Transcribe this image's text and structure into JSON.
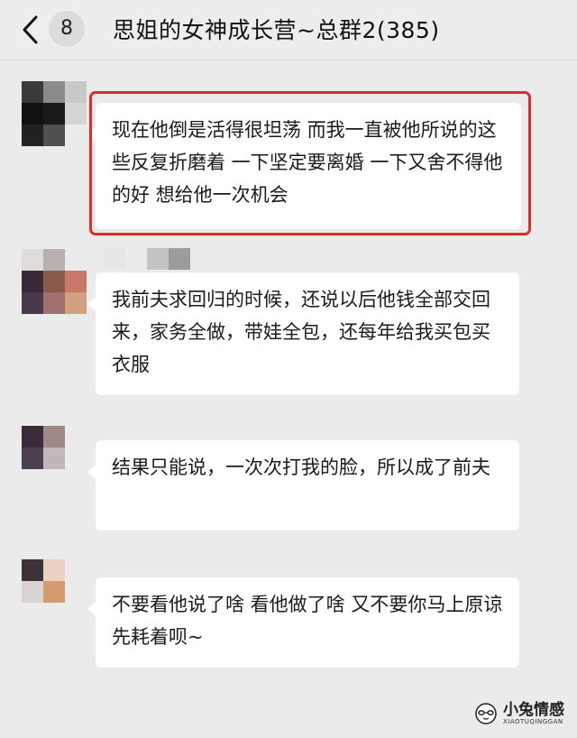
{
  "header": {
    "unread_count": "8",
    "title": "思姐的女神成长营~总群2(385)"
  },
  "messages": [
    {
      "text": "现在他倒是活得很坦荡 而我一直被他所说的这些反复折磨着 一下坚定要离婚 一下又舍不得他的好 想给他一次机会",
      "highlighted": true,
      "avatar_colors": [
        "#3a3a3a",
        "#8a8a8a",
        "#c8c8c8",
        "#111111",
        "#1a1a1a",
        "#d4d4d4",
        "#222222",
        "#505050",
        "#ebebeb"
      ]
    },
    {
      "text": "我前夫求回归的时候，还说以后他钱全部交回来，家务全做，带娃全包，还每年给我买包买衣服",
      "highlighted": false,
      "avatar_colors": [
        "#e0dcdc",
        "#b8b0b0",
        "#ebebeb",
        "#3a2a38",
        "#8a5a4a",
        "#c87868",
        "#4a3a4a",
        "#a07070",
        "#d0a080"
      ]
    },
    {
      "text": "结果只能说，一次次打我的脸，所以成了前夫",
      "highlighted": false,
      "avatar_colors": [
        "#3a2a3a",
        "#a08888",
        "#ebebeb",
        "#4a4050",
        "#c0b8b8",
        "#ebebeb",
        "#ebebeb",
        "#ebebeb",
        "#ebebeb"
      ]
    },
    {
      "text": "不要看他说了啥 看他做了啥 又不要你马上原谅 先耗着呗~",
      "highlighted": false,
      "avatar_colors": [
        "#3a3438",
        "#ecd2c4",
        "#ebebeb",
        "#d8d4d4",
        "#d49a70",
        "#ebebeb",
        "#ebebeb",
        "#ebebeb",
        "#ebebeb"
      ]
    }
  ],
  "watermark": {
    "name": "小兔情感",
    "sub": "XIAOTUQINGGAN"
  },
  "colors": {
    "background": "#ebebeb",
    "bubble": "#ffffff",
    "highlight_border": "#e02b2b"
  }
}
